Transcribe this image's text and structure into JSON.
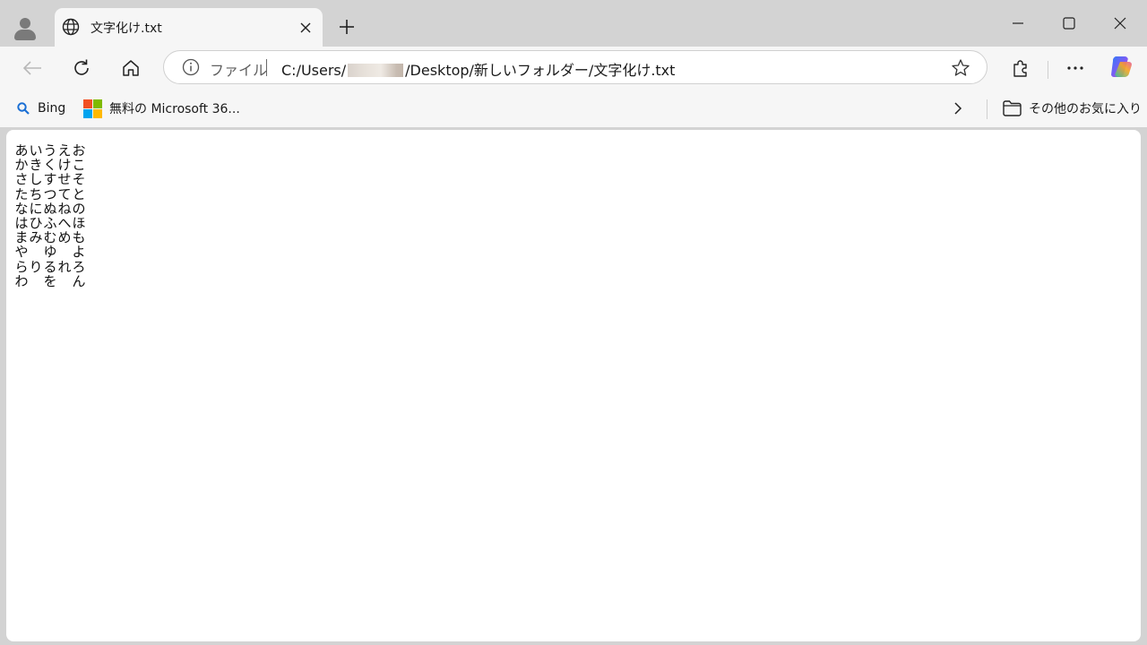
{
  "tab": {
    "icon": "globe-icon",
    "title": "文字化け.txt",
    "close_icon": "close-icon"
  },
  "titlebar": {
    "profile_icon": "profile-avatar-icon",
    "new_tab_icon": "plus-icon",
    "minimize_icon": "minimize-icon",
    "maximize_icon": "maximize-icon",
    "close_icon": "close-window-icon"
  },
  "toolbar": {
    "back_icon": "back-arrow-icon",
    "refresh_icon": "refresh-icon",
    "home_icon": "home-icon",
    "address": {
      "info_icon": "info-icon",
      "scheme_label": "ファイル",
      "url_prefix": "C:/Users/",
      "url_suffix": "/Desktop/新しいフォルダー/文字化け.txt",
      "favorite_icon": "star-icon"
    },
    "extensions_icon": "puzzle-icon",
    "more_icon": "ellipsis-icon",
    "copilot_icon": "copilot-icon",
    "colors": {
      "copilot_gradient": [
        "#2f7cf6",
        "#7b5cf5",
        "#e75b9c",
        "#f5a623",
        "#36c2a2"
      ]
    }
  },
  "favorites": {
    "items": [
      {
        "label": "Bing",
        "icon": "search-icon"
      },
      {
        "label": "無料の Microsoft 36...",
        "icon": "microsoft-logo-icon"
      }
    ],
    "overflow_icon": "chevron-right-icon",
    "other_label": "その他のお気に入り",
    "other_icon": "folder-icon"
  },
  "document": {
    "lines": [
      [
        "あ",
        "い",
        "う",
        "え",
        "お"
      ],
      [
        "か",
        "き",
        "く",
        "け",
        "こ"
      ],
      [
        "さ",
        "し",
        "す",
        "せ",
        "そ"
      ],
      [
        "た",
        "ち",
        "つ",
        "て",
        "と"
      ],
      [
        "な",
        "に",
        "ぬ",
        "ね",
        "の"
      ],
      [
        "は",
        "ひ",
        "ふ",
        "へ",
        "ほ"
      ],
      [
        "ま",
        "み",
        "む",
        "め",
        "も"
      ],
      [
        "や",
        " ",
        "ゆ",
        " ",
        "よ"
      ],
      [
        "ら",
        "り",
        "る",
        "れ",
        "ろ"
      ],
      [
        "わ",
        " ",
        "を",
        " ",
        "ん"
      ]
    ]
  }
}
